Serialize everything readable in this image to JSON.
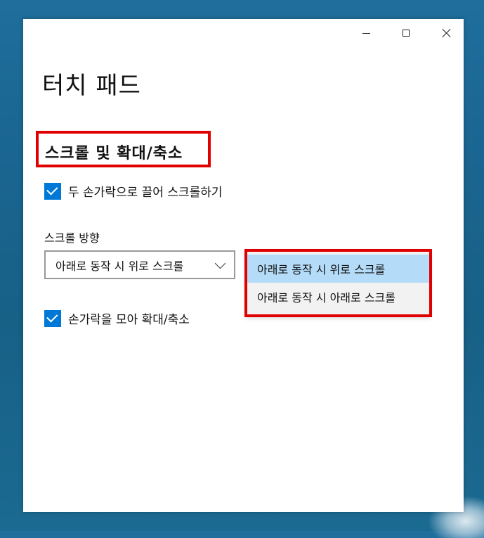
{
  "window": {
    "title": "터치 패드",
    "caption_buttons": {
      "minimize_icon": "minimize-icon",
      "maximize_icon": "maximize-icon",
      "close_icon": "close-icon"
    }
  },
  "section": {
    "heading": "스크롤 및 확대/축소"
  },
  "settings": {
    "drag_scroll": {
      "label": "두 손가락으로 끌어 스크롤하기",
      "checked": true
    },
    "scroll_direction": {
      "label": "스크롤 방향",
      "selected": "아래로 동작 시 위로 스크롤",
      "options": [
        "아래로 동작 시 위로 스크롤",
        "아래로 동작 시 아래로 스크롤"
      ],
      "highlighted_index": 0
    },
    "pinch_zoom": {
      "label": "손가락을 모아 확대/축소",
      "checked": true
    }
  },
  "colors": {
    "accent": "#0078d7",
    "highlight_box": "#e00000",
    "option_hover": "#b4dcf8",
    "desktop": "#1a6591"
  }
}
